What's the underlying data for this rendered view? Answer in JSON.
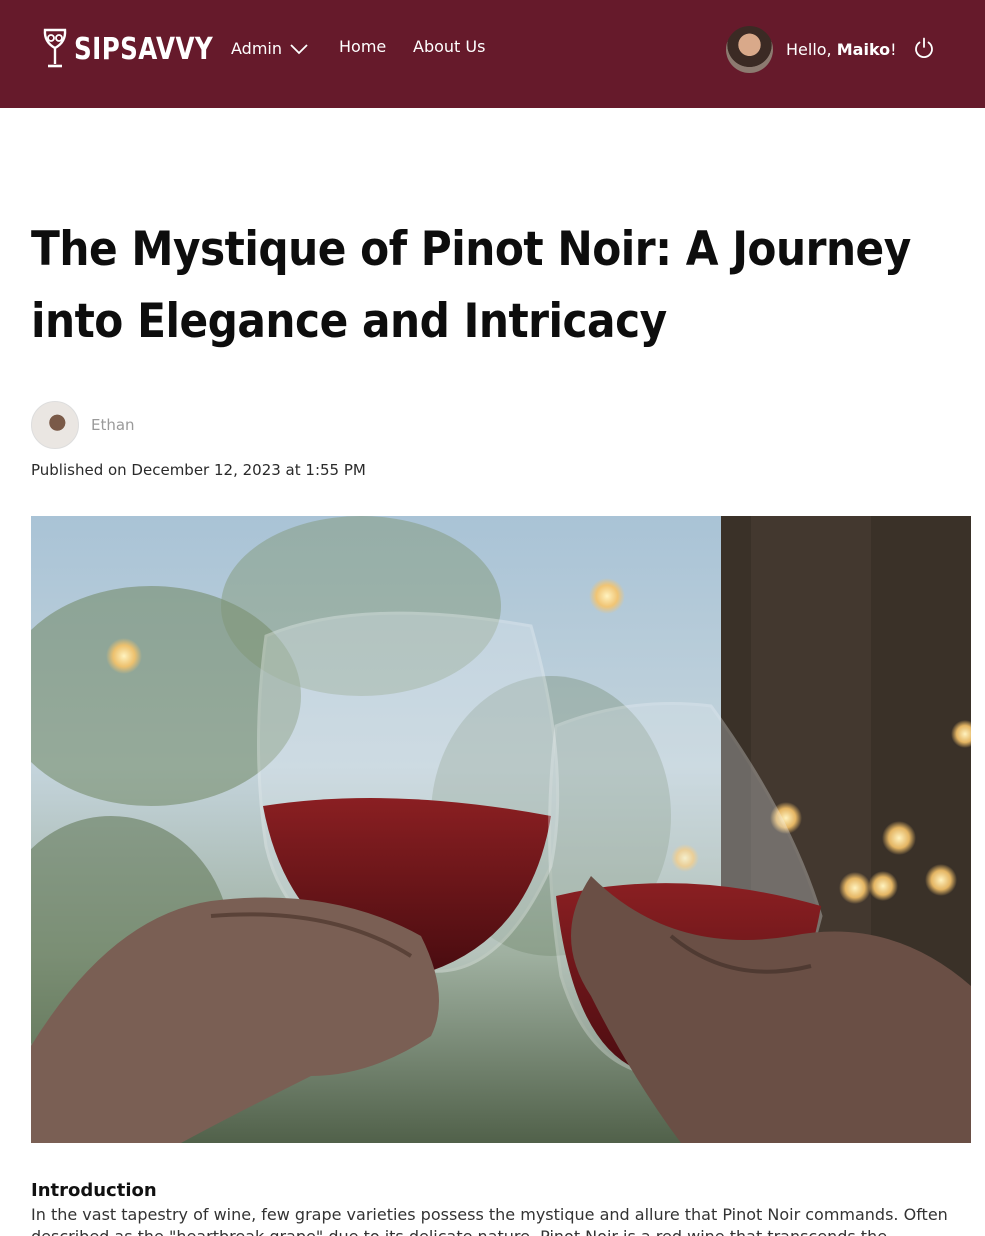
{
  "navbar": {
    "brand": "SIPSAVVY",
    "admin_label": "Admin",
    "home_label": "Home",
    "about_label": "About Us",
    "greeting_prefix": "Hello, ",
    "user_name": "Maiko",
    "greeting_suffix": "!"
  },
  "article": {
    "title": "The Mystique of Pinot Noir: A Journey into Elegance and Intricacy",
    "author": "Ethan",
    "published": "Published on December 12, 2023 at 1:55 PM",
    "section_heading": "Introduction",
    "intro_text": "In the vast tapestry of wine, few grape varieties possess the mystique and allure that Pinot Noir commands. Often described as the \"heartbreak grape\" due to its delicate nature, Pinot Noir is a red wine that transcends the ordinary."
  },
  "colors": {
    "navbar_bg": "#661a2b",
    "text_primary": "#0d0d0d",
    "text_muted": "#9a9a9a"
  }
}
